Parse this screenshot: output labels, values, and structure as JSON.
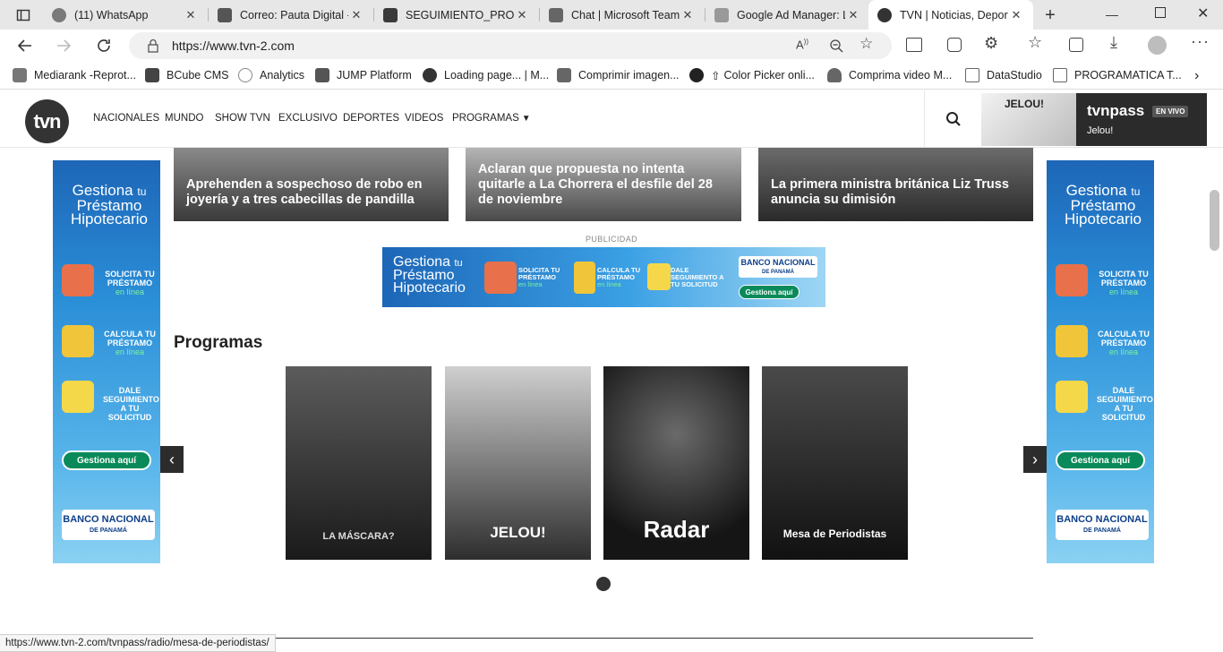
{
  "browser": {
    "tabs": [
      {
        "title": "(11) WhatsApp",
        "fav_color": "#25a244"
      },
      {
        "title": "Correo: Pauta Digital -",
        "fav_color": "#444444"
      },
      {
        "title": "SEGUIMIENTO_PROGR",
        "fav_color": "#1d6f42"
      },
      {
        "title": "Chat | Microsoft Team",
        "fav_color": "#5059c9"
      },
      {
        "title": "Google Ad Manager: L",
        "fav_color": "#888888"
      },
      {
        "title": "TVN | Noticias, Deport",
        "fav_color": "#333333"
      }
    ],
    "url": "https://www.tvn-2.com",
    "favorites": [
      {
        "label": "Mediarank -Reprot..."
      },
      {
        "label": "BCube CMS"
      },
      {
        "label": "Analytics"
      },
      {
        "label": "JUMP Platform"
      },
      {
        "label": "Loading page... | M..."
      },
      {
        "label": "Comprimir imagen..."
      },
      {
        "label": "Color Picker onli..."
      },
      {
        "label": "Comprima  video M..."
      },
      {
        "label": "DataStudio"
      },
      {
        "label": "PROGRAMATICA T..."
      }
    ],
    "status_url": "https://www.tvn-2.com/tvnpass/radio/mesa-de-periodistas/"
  },
  "site": {
    "logo": "tvn",
    "nav": [
      "NACIONALES",
      "MUNDO",
      "SHOW TVN",
      "EXCLUSIVO",
      "DEPORTES",
      "VIDEOS",
      "PROGRAMAS"
    ],
    "pass": {
      "brand": "tvnpass",
      "badge": "EN VIVO",
      "show": "Jelou!",
      "thumb_text": "JELOU!"
    },
    "news": [
      {
        "headline": "Aprehenden a sospechoso de robo en joyería y a tres cabecillas de pandilla"
      },
      {
        "headline": "Aclaran que propuesta no intenta quitarle a La Chorrera el desfile del 28 de noviembre"
      },
      {
        "headline": "La primera ministra británica Liz Truss anuncia su dimisión"
      }
    ],
    "publicidad_label": "PUBLICIDAD",
    "ad": {
      "title_1": "Gestiona",
      "title_2": "tu",
      "title_3": "Préstamo",
      "title_4": "Hipotecario",
      "item_1": "SOLICITA TU PRÉSTAMO",
      "item_1_sub": "en línea",
      "item_2": "CALCULA TU PRÉSTAMO",
      "item_2_sub": "en línea",
      "item_3": "DALE SEGUIMIENTO A TU SOLICITUD",
      "cta": "Gestiona aquí",
      "bank": "BANCO NACIONAL",
      "bank_sub": "DE PANAMÁ"
    },
    "section_title": "Programas",
    "programs": [
      {
        "name": "LA MÁSCARA?"
      },
      {
        "name": "JELOU!"
      },
      {
        "name": "Radar"
      },
      {
        "name": "Mesa de Periodistas"
      }
    ]
  }
}
